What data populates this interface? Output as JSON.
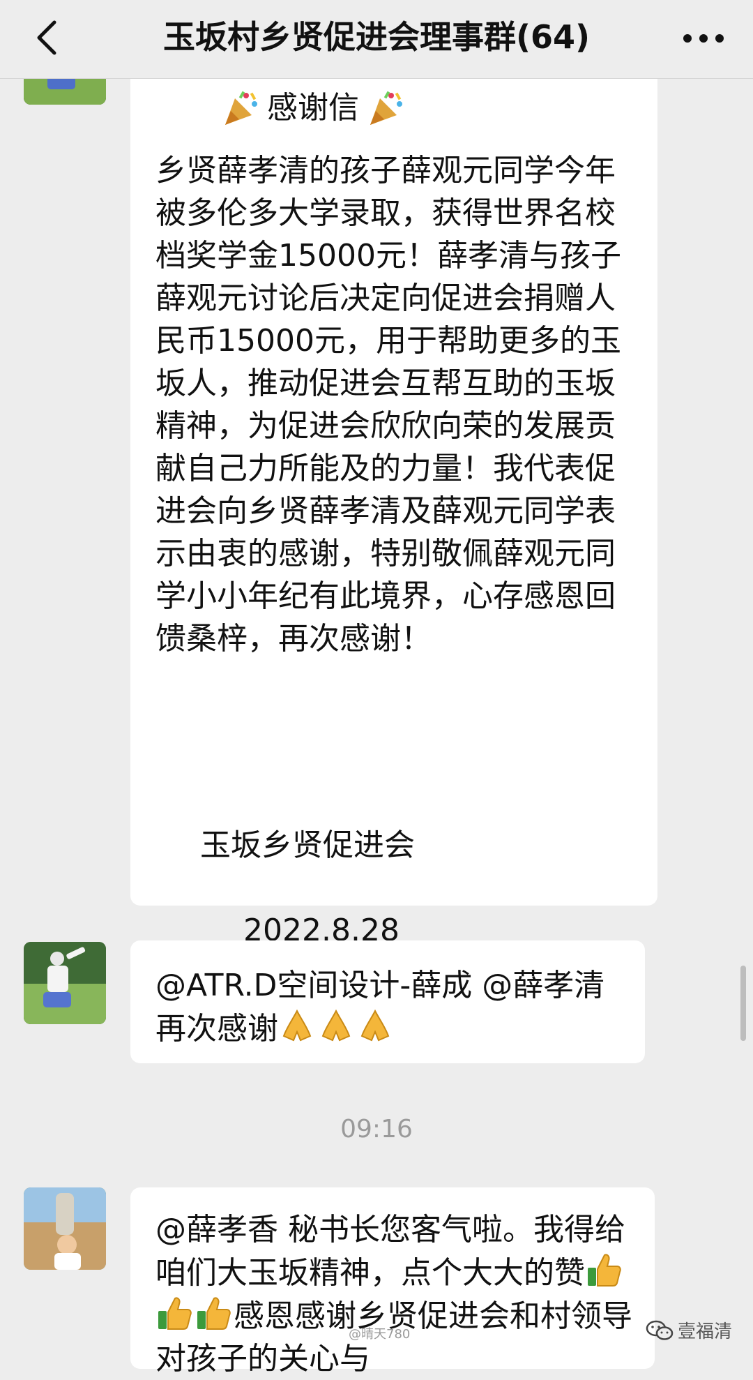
{
  "header": {
    "title": "玉坂村乡贤促进会理事群(64)",
    "back_icon": "chevron-left-icon",
    "more_icon": "more-dots-icon"
  },
  "letter": {
    "title": "感谢信",
    "body": "乡贤薛孝清的孩子薛观元同学今年被多伦多大学录取，获得世界名校档奖学金15000元！薛孝清与孩子薛观元讨论后决定向促进会捐赠人民币15000元，用于帮助更多的玉坂人，推动促进会互帮互助的玉坂精神，为促进会欣欣向荣的发展贡献自己力所能及的力量！我代表促进会向乡贤薛孝清及薛观元同学表示由衷的感谢，特别敬佩薛观元同学小小年纪有此境界，心存感恩回馈桑梓，再次感谢！",
    "signature": "玉坂乡贤促进会",
    "date": "2022.8.28"
  },
  "message2": {
    "text": "@ATR.D空间设计-薛成 @薛孝清 再次感谢"
  },
  "timestamp": "09:16",
  "message3": {
    "text_part1": "@薛孝香 秘书长您客气啦。我得给咱们大玉坂精神，点个大大的赞",
    "text_part2": "感恩感谢乡贤促进会和村领导对孩子的关心与"
  },
  "watermark": {
    "label": "壹福清",
    "small": "@晴天780"
  },
  "colors": {
    "background": "#ededed",
    "bubble": "#ffffff",
    "timestamp": "#9a9a9a"
  }
}
